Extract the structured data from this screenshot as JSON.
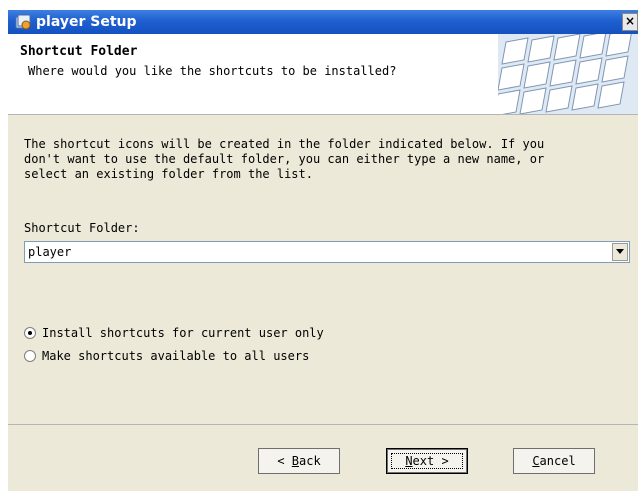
{
  "window": {
    "title": "player Setup",
    "close_label": "×"
  },
  "header": {
    "title": "Shortcut Folder",
    "subtitle": "Where would you like the shortcuts to be installed?"
  },
  "body": {
    "description": "The shortcut icons will be created in the folder indicated below. If you\ndon't want to use the default folder, you can either type a new name, or\nselect an existing folder from the list.",
    "folder_label": "Shortcut Folder:",
    "folder_value": "player",
    "options": [
      {
        "label": "Install shortcuts for current user only",
        "selected": true
      },
      {
        "label": "Make shortcuts available to all users",
        "selected": false
      }
    ]
  },
  "buttons": {
    "back_prefix": "< ",
    "back_mnemonic": "B",
    "back_rest": "ack",
    "next_mnemonic": "N",
    "next_rest": "ext >",
    "cancel_mnemonic": "C",
    "cancel_rest": "ancel"
  },
  "colors": {
    "titlebar": "#1f5fd0",
    "dialog_bg": "#ece9d8"
  }
}
